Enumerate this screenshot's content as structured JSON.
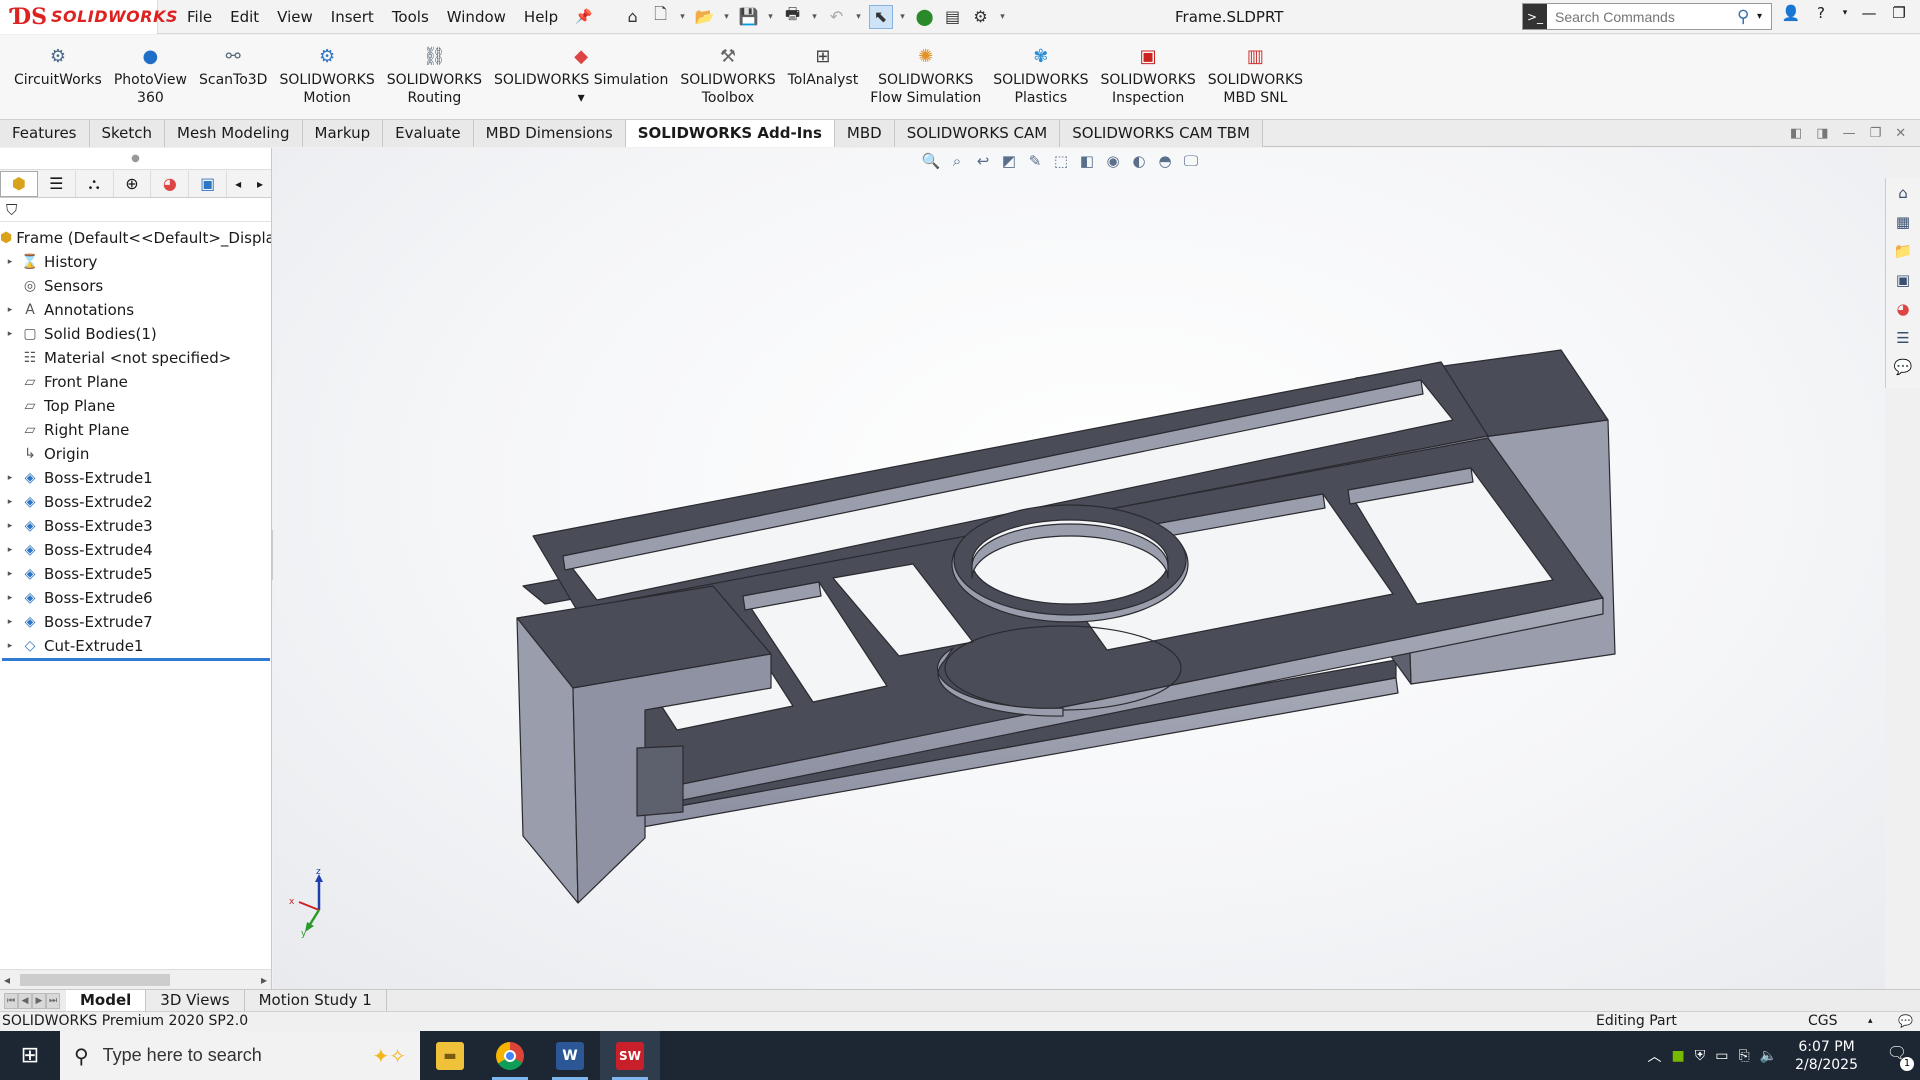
{
  "app": {
    "logo_text": "SOLIDWORKS",
    "document_title": "Frame.SLDPRT"
  },
  "menu": [
    "File",
    "Edit",
    "View",
    "Insert",
    "Tools",
    "Window",
    "Help"
  ],
  "search": {
    "placeholder": "Search Commands"
  },
  "ribbon": [
    {
      "line1": "CircuitWorks",
      "line2": "",
      "icon": "circuit-icon",
      "color": "#4a6b8a"
    },
    {
      "line1": "PhotoView",
      "line2": "360",
      "icon": "photoview-icon",
      "color": "#1f6fc7"
    },
    {
      "line1": "ScanTo3D",
      "line2": "",
      "icon": "scan-icon",
      "color": "#5a6b7a"
    },
    {
      "line1": "SOLIDWORKS",
      "line2": "Motion",
      "icon": "motion-icon",
      "color": "#2f77c4"
    },
    {
      "line1": "SOLIDWORKS",
      "line2": "Routing",
      "icon": "routing-icon",
      "color": "#556677"
    },
    {
      "line1": "SOLIDWORKS Simulation",
      "line2": "▾",
      "icon": "simulation-icon",
      "color": "#d44"
    },
    {
      "line1": "SOLIDWORKS",
      "line2": "Toolbox",
      "icon": "toolbox-icon",
      "color": "#666"
    },
    {
      "line1": "TolAnalyst",
      "line2": "",
      "icon": "tolanalyst-icon",
      "color": "#444"
    },
    {
      "line1": "SOLIDWORKS",
      "line2": "Flow Simulation",
      "icon": "flow-icon",
      "color": "#e0932a"
    },
    {
      "line1": "SOLIDWORKS",
      "line2": "Plastics",
      "icon": "plastics-icon",
      "color": "#2d8fd6"
    },
    {
      "line1": "SOLIDWORKS",
      "line2": "Inspection",
      "icon": "inspection-icon",
      "color": "#c22"
    },
    {
      "line1": "SOLIDWORKS",
      "line2": "MBD SNL",
      "icon": "mbd-snl-icon",
      "color": "#c33"
    }
  ],
  "tabs": [
    {
      "label": "Features",
      "active": false
    },
    {
      "label": "Sketch",
      "active": false
    },
    {
      "label": "Mesh Modeling",
      "active": false
    },
    {
      "label": "Markup",
      "active": false
    },
    {
      "label": "Evaluate",
      "active": false
    },
    {
      "label": "MBD Dimensions",
      "active": false
    },
    {
      "label": "SOLIDWORKS Add-Ins",
      "active": true
    },
    {
      "label": "MBD",
      "active": false
    },
    {
      "label": "SOLIDWORKS CAM",
      "active": false
    },
    {
      "label": "SOLIDWORKS CAM TBM",
      "active": false
    }
  ],
  "tree": {
    "root": "Frame  (Default<<Default>_Display S",
    "items": [
      {
        "label": "History",
        "expandable": true,
        "icon": "history-icon"
      },
      {
        "label": "Sensors",
        "expandable": false,
        "icon": "sensors-icon"
      },
      {
        "label": "Annotations",
        "expandable": true,
        "icon": "annotations-icon"
      },
      {
        "label": "Solid Bodies(1)",
        "expandable": true,
        "icon": "solid-bodies-icon"
      },
      {
        "label": "Material <not specified>",
        "expandable": false,
        "icon": "material-icon"
      },
      {
        "label": "Front Plane",
        "expandable": false,
        "icon": "plane-icon"
      },
      {
        "label": "Top Plane",
        "expandable": false,
        "icon": "plane-icon"
      },
      {
        "label": "Right Plane",
        "expandable": false,
        "icon": "plane-icon"
      },
      {
        "label": "Origin",
        "expandable": false,
        "icon": "origin-icon"
      },
      {
        "label": "Boss-Extrude1",
        "expandable": true,
        "icon": "boss-extrude-icon"
      },
      {
        "label": "Boss-Extrude2",
        "expandable": true,
        "icon": "boss-extrude-icon"
      },
      {
        "label": "Boss-Extrude3",
        "expandable": true,
        "icon": "boss-extrude-icon"
      },
      {
        "label": "Boss-Extrude4",
        "expandable": true,
        "icon": "boss-extrude-icon"
      },
      {
        "label": "Boss-Extrude5",
        "expandable": true,
        "icon": "boss-extrude-icon"
      },
      {
        "label": "Boss-Extrude6",
        "expandable": true,
        "icon": "boss-extrude-icon"
      },
      {
        "label": "Boss-Extrude7",
        "expandable": true,
        "icon": "boss-extrude-icon"
      },
      {
        "label": "Cut-Extrude1",
        "expandable": true,
        "icon": "cut-extrude-icon"
      }
    ]
  },
  "bottom_tabs": [
    {
      "label": "Model",
      "active": true
    },
    {
      "label": "3D Views",
      "active": false
    },
    {
      "label": "Motion Study 1",
      "active": false
    }
  ],
  "status": {
    "left": "SOLIDWORKS Premium 2020 SP2.0",
    "mode": "Editing Part",
    "units": "CGS"
  },
  "triad": {
    "x": "x",
    "y": "y",
    "z": "z"
  },
  "taskbar": {
    "search_placeholder": "Type here to search",
    "time": "6:07 PM",
    "date": "2/8/2025",
    "notification_count": "1"
  },
  "colors": {
    "accent": "#2f7bd3",
    "model_top": "#4a4d57",
    "model_side": "#9a9dab",
    "model_dark": "#5d606d",
    "brand_red": "#d22222"
  }
}
